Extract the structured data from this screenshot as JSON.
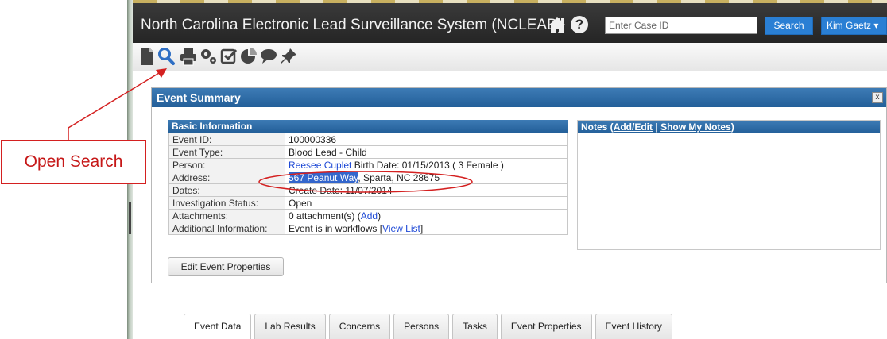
{
  "header": {
    "title": "North Carolina Electronic Lead Surveillance System (NCLEAD)",
    "case_input_placeholder": "Enter Case ID",
    "search_label": "Search",
    "user_label": "Kim Gaetz",
    "user_caret": "▾",
    "help_label": "?"
  },
  "toolbar": {
    "icons": [
      "new-document-icon",
      "search-icon",
      "print-icon",
      "gears-icon",
      "checkbox-icon",
      "pie-chart-icon",
      "chat-icon",
      "pin-icon"
    ]
  },
  "annotation": {
    "callout_text": "Open Search",
    "color": "#d42020"
  },
  "event_summary": {
    "title": "Event Summary",
    "close_label": "x",
    "basic_info_heading": "Basic Information",
    "rows": {
      "event_id": {
        "label": "Event ID:",
        "value": "100000336"
      },
      "event_type": {
        "label": "Event Type:",
        "value": "Blood Lead - Child"
      },
      "person": {
        "label": "Person:",
        "name": "Reesee Cuplet",
        "details": " Birth Date: 01/15/2013 ( 3 Female )"
      },
      "address": {
        "label": "Address:",
        "street": "567 Peanut Way",
        "rest": ", Sparta, NC 28675"
      },
      "dates": {
        "label": "Dates:",
        "value": "Create Date: 11/07/2014"
      },
      "investigation_status": {
        "label": "Investigation Status:",
        "value": "Open"
      },
      "attachments": {
        "label": "Attachments:",
        "prefix": "0 attachment(s) (",
        "link": "Add",
        "suffix": ")"
      },
      "additional_info": {
        "label": "Additional Information:",
        "prefix": "Event is in workflows [",
        "link": "View List",
        "suffix": "]"
      }
    },
    "notes": {
      "heading": "Notes",
      "add_edit": "Add/Edit",
      "separator": "|",
      "show_my_notes": "Show My Notes"
    },
    "edit_button": "Edit Event Properties"
  },
  "tabs": [
    "Event Data",
    "Lab Results",
    "Concerns",
    "Persons",
    "Tasks",
    "Event Properties",
    "Event History"
  ],
  "colors": {
    "header_bg": "#2d2d2d",
    "accent_blue": "#2a7fd4",
    "panel_head": "#235f99",
    "link": "#1f4ad6",
    "annotation_red": "#d42020"
  }
}
